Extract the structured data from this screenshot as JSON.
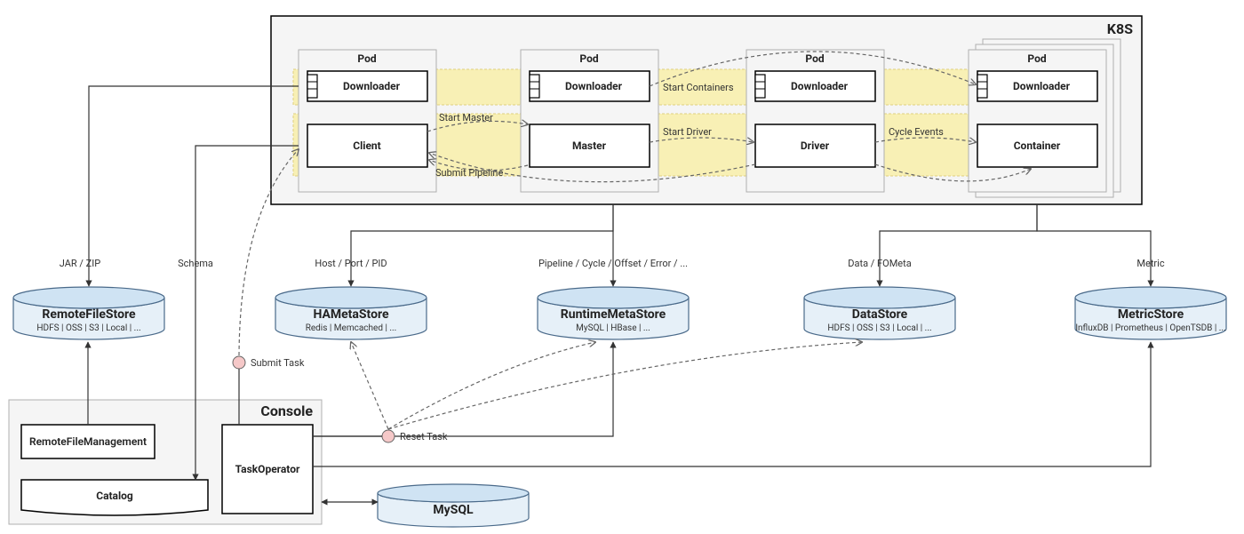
{
  "k8s": {
    "title": "K8S",
    "pods": [
      "Pod",
      "Pod",
      "Pod",
      "Pod"
    ],
    "downloaders": [
      "Downloader",
      "Downloader",
      "Downloader",
      "Downloader"
    ],
    "roles": [
      "Client",
      "Master",
      "Driver",
      "Container"
    ],
    "edges": {
      "start_master": "Start Master",
      "submit_pipeline": "Submit Pipeline",
      "start_driver": "Start Driver",
      "start_containers": "Start Containers",
      "cycle_events": "Cycle Events"
    }
  },
  "stores": {
    "remote_file": {
      "title": "RemoteFileStore",
      "sub": "HDFS | OSS | S3 | Local | ..."
    },
    "ha_meta": {
      "title": "HAMetaStore",
      "sub": "Redis | Memcached | ..."
    },
    "runtime_meta": {
      "title": "RuntimeMetaStore",
      "sub": "MySQL | HBase | ..."
    },
    "data": {
      "title": "DataStore",
      "sub": "HDFS | OSS | S3 | Local | ..."
    },
    "metric": {
      "title": "MetricStore",
      "sub": "InfluxDB | Prometheus | OpenTSDB | ..."
    },
    "mysql": {
      "title": "MySQL"
    }
  },
  "edge_labels": {
    "jar_zip": "JAR / ZIP",
    "schema": "Schema",
    "host_port_pid": "Host / Port / PID",
    "pipeline_cycle": "Pipeline / Cycle / Offset / Error / ...",
    "data_fometa": "Data / FOMeta",
    "metric": "Metric"
  },
  "console": {
    "title": "Console",
    "remote_file_mgmt": "RemoteFileManagement",
    "catalog": "Catalog",
    "task_operator": "TaskOperator"
  },
  "tasks": {
    "submit": "Submit Task",
    "reset": "Reset Task"
  }
}
